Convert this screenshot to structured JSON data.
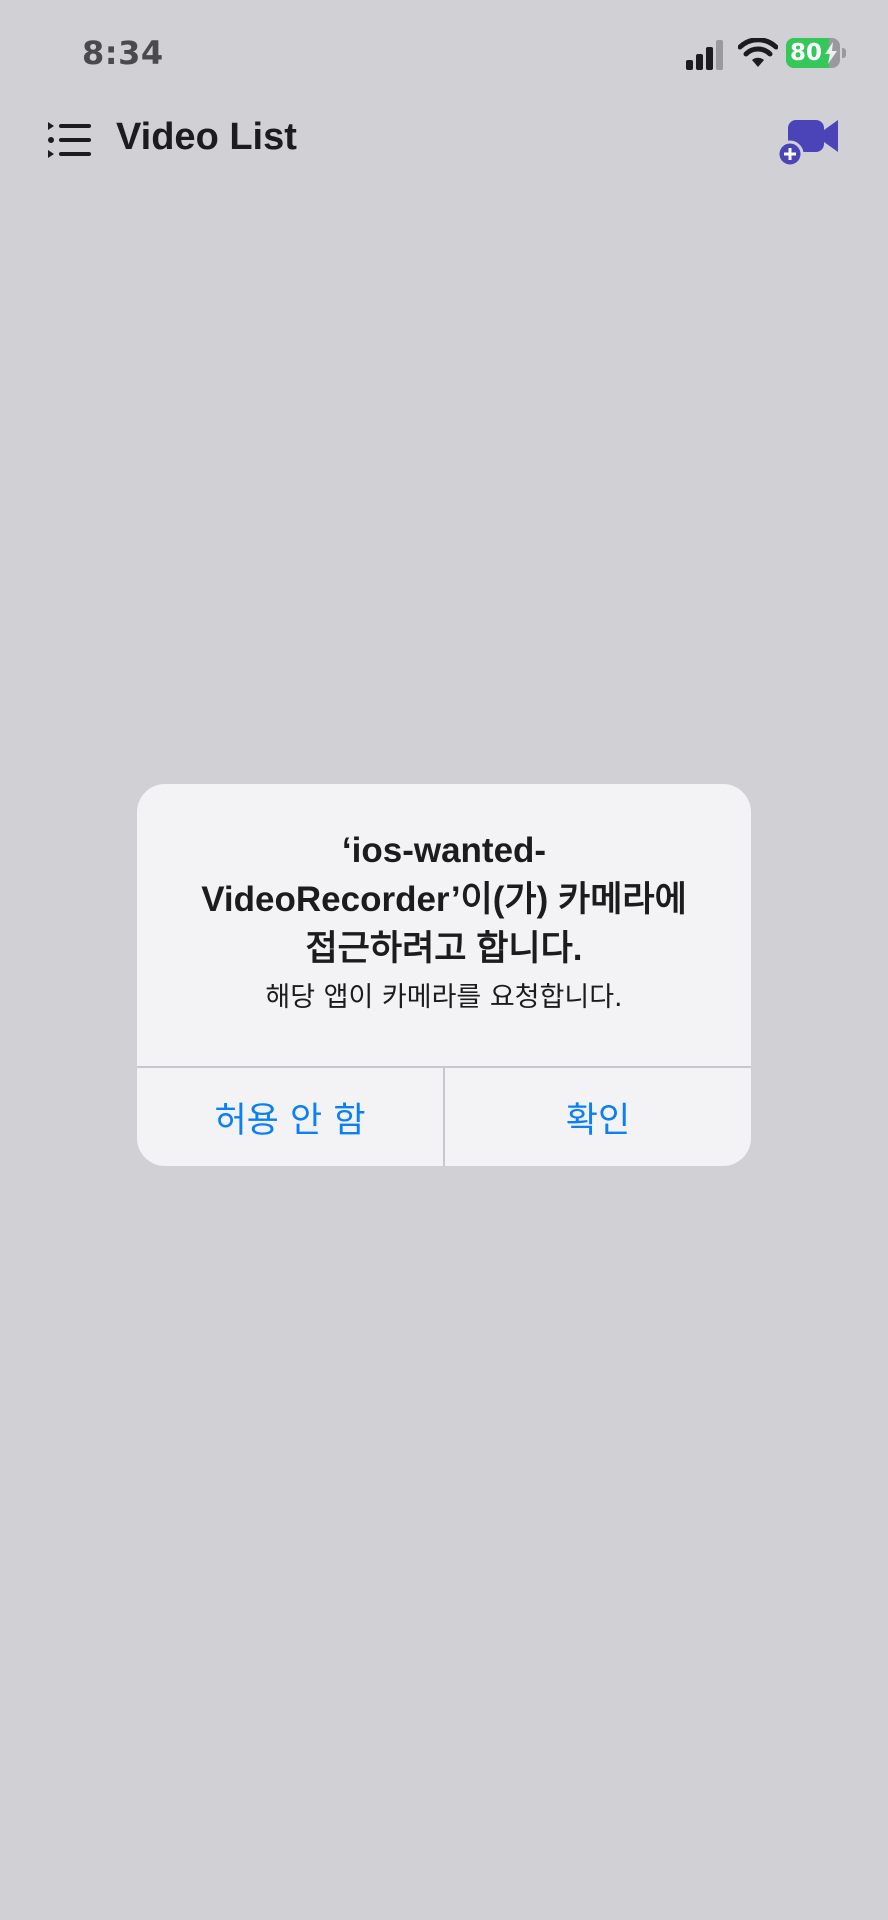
{
  "status_bar": {
    "time": "8:34",
    "battery_level": "80",
    "battery_fraction": 0.8,
    "battery_color": "#34c759"
  },
  "nav": {
    "title": "Video List",
    "left_icon": "list-icon",
    "right_icon": "video-add-icon",
    "accent_color": "#4a44b8"
  },
  "alert": {
    "title_line1": "‘ios-wanted-",
    "title_line2": "VideoRecorder’이(가) 카메라에",
    "title_line3": "접근하려고 합니다.",
    "message": "해당 앱이 카메라를 요청합니다.",
    "deny_label": "허용 안 함",
    "ok_label": "확인",
    "button_color": "#0a7ff6"
  }
}
